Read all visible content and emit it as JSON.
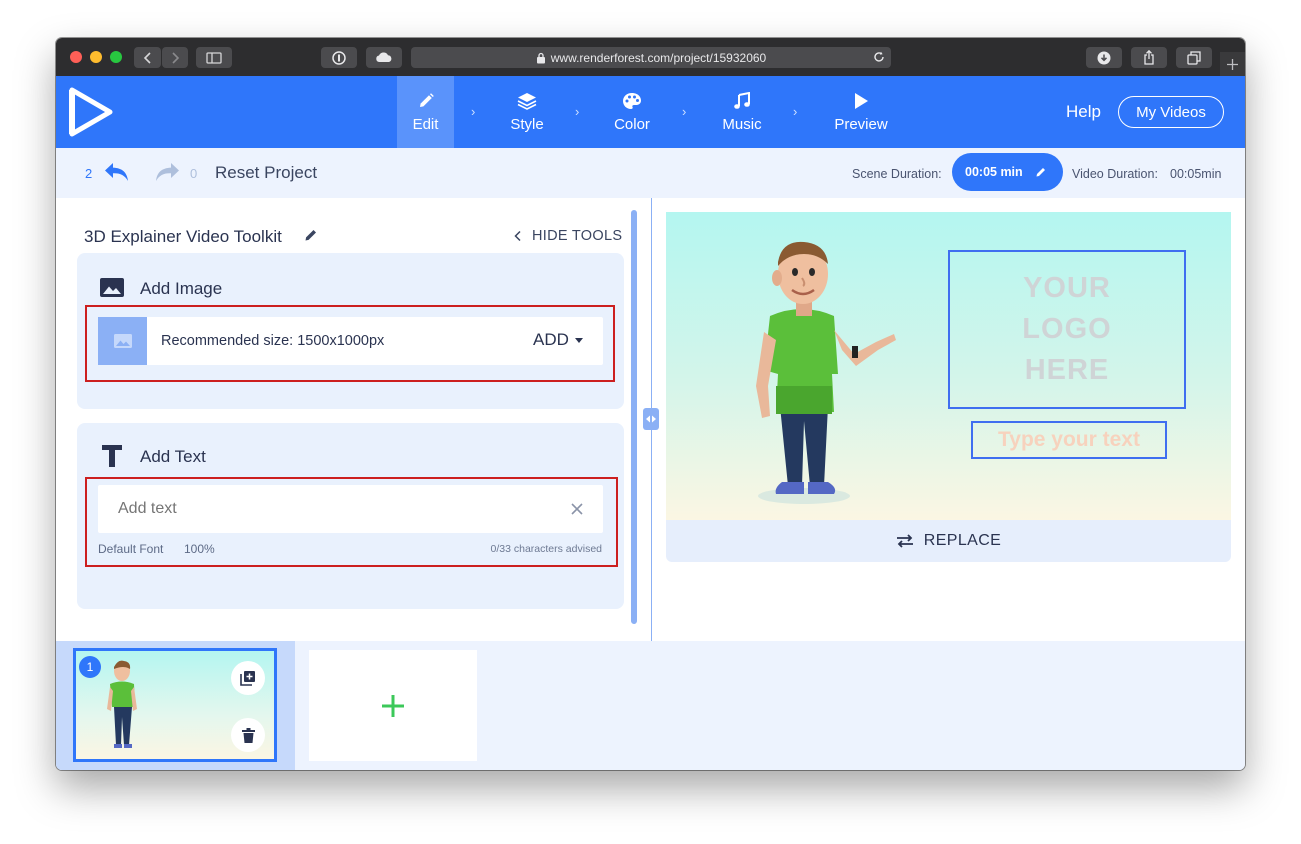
{
  "browser": {
    "url": "www.renderforest.com/project/15932060"
  },
  "nav": {
    "steps": [
      {
        "label": "Edit",
        "icon": "pencil-icon"
      },
      {
        "label": "Style",
        "icon": "layers-icon"
      },
      {
        "label": "Color",
        "icon": "palette-icon"
      },
      {
        "label": "Music",
        "icon": "music-note-icon"
      },
      {
        "label": "Preview",
        "icon": "play-icon"
      }
    ],
    "active_step": "Edit",
    "help_label": "Help",
    "my_videos_label": "My Videos",
    "accent": "#2f76fa"
  },
  "toolbar": {
    "undo_count": "2",
    "redo_count": "0",
    "reset_label": "Reset Project",
    "scene_duration_label": "Scene Duration:",
    "scene_duration_value": "00:05 min",
    "video_duration_label": "Video Duration:",
    "video_duration_value": "00:05min"
  },
  "panel": {
    "project_title": "3D Explainer Video Toolkit",
    "hide_tools_label": "HIDE TOOLS",
    "add_image": {
      "title": "Add Image",
      "recommended": "Recommended size: 1500x1000px",
      "add_label": "ADD"
    },
    "add_text": {
      "title": "Add Text",
      "placeholder": "Add text",
      "value": "",
      "font_label": "Default Font",
      "font_scale": "100%",
      "char_count": "0/33 characters advised"
    }
  },
  "preview": {
    "logo_lines": [
      "YOUR",
      "LOGO",
      "HERE"
    ],
    "text_placeholder": "Type your text",
    "replace_label": "REPLACE"
  },
  "timeline": {
    "scenes": [
      {
        "number": "1"
      }
    ],
    "add_scene_icon": "plus-icon"
  }
}
